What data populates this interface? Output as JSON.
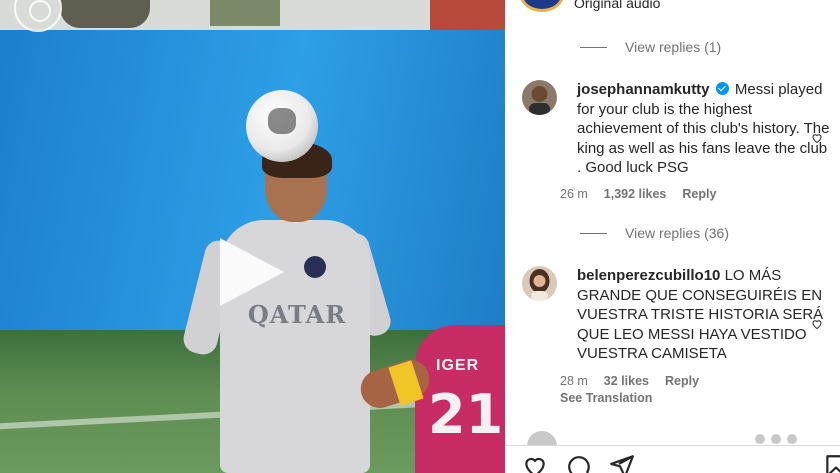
{
  "post": {
    "audio_label": "Original audio"
  },
  "video": {
    "sponsor_text": "QATAR",
    "opponent_number": "21",
    "opponent_name": "IGER",
    "play_icon": "play-icon"
  },
  "comments": [
    {
      "replies_label": "View replies (1)"
    },
    {
      "username": "josephannamkutty",
      "verified": true,
      "text": "Messi played for your club is the highest achievement of this club's history. The king as well as his fans leave the club . Good luck PSG",
      "time": "26 m",
      "likes": "1,392 likes",
      "reply_label": "Reply",
      "replies_label": "View replies (36)"
    },
    {
      "username": "belenperezcubillo10",
      "verified": false,
      "text": "LO MÁS GRANDE QUE CONSEGUIRÉIS EN VUESTRA TRISTE HISTORIA SERÁ QUE LEO MESSI HAYA VESTIDO VUESTRA CAMISETA",
      "time": "28 m",
      "likes": "32 likes",
      "reply_label": "Reply",
      "translation_label": "See Translation"
    }
  ],
  "actions": [
    "heart-icon",
    "comment-icon",
    "share-icon",
    "bookmark-icon"
  ],
  "colors": {
    "verified": "#0095f6",
    "secondary_text": "#737373",
    "primary_text": "#262626"
  }
}
